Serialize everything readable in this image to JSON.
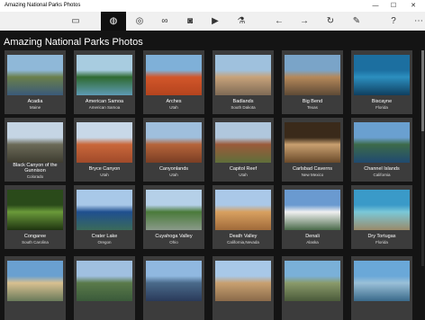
{
  "window": {
    "title": "Amazing National Parks Photos",
    "minimize": "—",
    "maximize": "☐",
    "close": "✕"
  },
  "toolbar": {
    "icons": [
      "screen-icon",
      "globe-dark-icon",
      "globe-icon",
      "binoculars-icon",
      "camera-icon",
      "video-icon",
      "flask-icon",
      "arrow-left-icon",
      "arrow-right-icon",
      "refresh-icon",
      "pencil-icon",
      "help-icon",
      "more-icon"
    ],
    "glyphs": [
      "▭",
      "◍",
      "◎",
      "∞",
      "◙",
      "▶",
      "⚗",
      "←",
      "→",
      "↻",
      "✎",
      "?",
      "⋯"
    ]
  },
  "heading": "Amazing National Parks Photos",
  "parks": [
    {
      "name": "Acadia",
      "state": "Maine",
      "colors": [
        "#8fb8d8",
        "#6a7f4a",
        "#3a5a7a"
      ]
    },
    {
      "name": "American Samoa",
      "state": "American Samoa",
      "colors": [
        "#a8cce0",
        "#2f6a30",
        "#5e9bb5"
      ]
    },
    {
      "name": "Arches",
      "state": "Utah",
      "colors": [
        "#7fb0d8",
        "#d2562a",
        "#b4441e"
      ]
    },
    {
      "name": "Badlands",
      "state": "South Dakota",
      "colors": [
        "#9fc1dd",
        "#c7a27a",
        "#7e6a55"
      ]
    },
    {
      "name": "Big Bend",
      "state": "Texas",
      "colors": [
        "#7aa4c8",
        "#b5885a",
        "#5e4a36"
      ]
    },
    {
      "name": "Biscayne",
      "state": "Florida",
      "colors": [
        "#1c6fa0",
        "#2c8fbf",
        "#0f3f60"
      ]
    },
    {
      "name": "Black Canyon of the Gunnison",
      "state": "Colorado",
      "colors": [
        "#c5d5e4",
        "#6b6a58",
        "#3e3c30"
      ]
    },
    {
      "name": "Bryce Canyon",
      "state": "Utah",
      "colors": [
        "#c8d8e8",
        "#c9673a",
        "#a04a2a"
      ]
    },
    {
      "name": "Canyonlands",
      "state": "Utah",
      "colors": [
        "#9fbfdd",
        "#b5643a",
        "#7a3e24"
      ]
    },
    {
      "name": "Capitol Reef",
      "state": "Utah",
      "colors": [
        "#b0c7dd",
        "#9a5a3a",
        "#5f6e3a"
      ]
    },
    {
      "name": "Carlsbad Caverns",
      "state": "New Mexico",
      "colors": [
        "#3a2a1a",
        "#c9a070",
        "#6a4a2a"
      ]
    },
    {
      "name": "Channel Islands",
      "state": "California",
      "colors": [
        "#6aa0d0",
        "#3c6a4a",
        "#204a70"
      ]
    },
    {
      "name": "Congaree",
      "state": "South Carolina",
      "colors": [
        "#2a4a1a",
        "#6a9a3a",
        "#1f3510"
      ]
    },
    {
      "name": "Crater Lake",
      "state": "Oregon",
      "colors": [
        "#a8c8e8",
        "#1f4f8f",
        "#3a6a5a"
      ]
    },
    {
      "name": "Cuyahoga Valley",
      "state": "Ohio",
      "colors": [
        "#b5d0e8",
        "#4a7a3a",
        "#8a9a8a"
      ]
    },
    {
      "name": "Death Valley",
      "state": "California,Nevada",
      "colors": [
        "#aac8e8",
        "#d8a060",
        "#a06a3a"
      ]
    },
    {
      "name": "Denali",
      "state": "Alaska",
      "colors": [
        "#6a9ad0",
        "#f0f0f0",
        "#4a6a4a"
      ]
    },
    {
      "name": "Dry Tortugas",
      "state": "Florida",
      "colors": [
        "#3a9ac8",
        "#7ac8d8",
        "#9a8a6a"
      ]
    },
    {
      "name": "",
      "state": "",
      "colors": [
        "#6aa0d0",
        "#d8c090",
        "#6a7a5a"
      ]
    },
    {
      "name": "",
      "state": "",
      "colors": [
        "#a0c0e0",
        "#5a7a4a",
        "#3a5a3a"
      ]
    },
    {
      "name": "",
      "state": "",
      "colors": [
        "#90b8e0",
        "#4a6a8a",
        "#2a3a5a"
      ]
    },
    {
      "name": "",
      "state": "",
      "colors": [
        "#a8c8e8",
        "#c8a070",
        "#8a6a4a"
      ]
    },
    {
      "name": "",
      "state": "",
      "colors": [
        "#7ab0d8",
        "#8a9a6a",
        "#4a5a3a"
      ]
    },
    {
      "name": "",
      "state": "",
      "colors": [
        "#6aa8d8",
        "#9ac0d8",
        "#3a6a8a"
      ]
    }
  ],
  "scrollbar": {
    "position": 0
  }
}
